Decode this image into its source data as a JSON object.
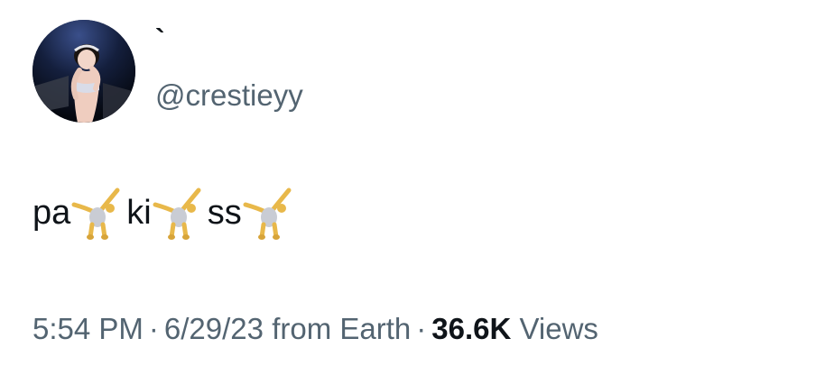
{
  "author": {
    "display_name": "`",
    "handle": "@crestieyy",
    "avatar_icon": "profile-photo-avatar"
  },
  "tweet": {
    "segments": [
      {
        "text": "pa",
        "emoji": "cartwheel-emoji"
      },
      {
        "text": "ki",
        "emoji": "cartwheel-emoji"
      },
      {
        "text": "ss",
        "emoji": "cartwheel-emoji"
      }
    ]
  },
  "meta": {
    "time": "5:54 PM",
    "date": "6/29/23",
    "source": "from Earth",
    "separator": "·",
    "views_count": "36.6K",
    "views_label": "Views"
  },
  "colors": {
    "text_primary": "#0f1419",
    "text_secondary": "#536471",
    "background": "#ffffff"
  }
}
